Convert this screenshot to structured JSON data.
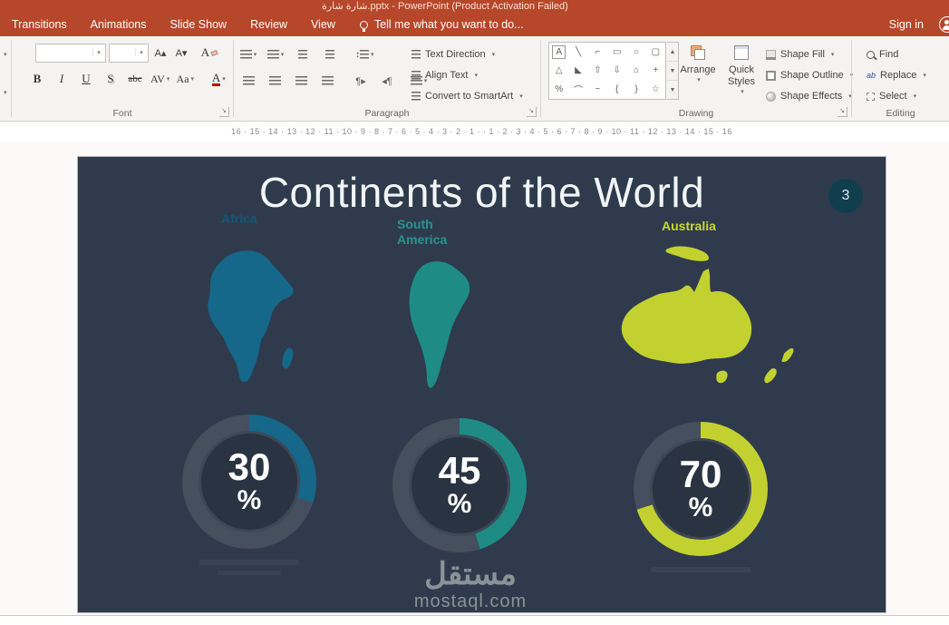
{
  "title_bar": {
    "title": "شارة شارة.pptx - PowerPoint (Product Activation Failed)"
  },
  "tab_bar": {
    "tabs": [
      "Transitions",
      "Animations",
      "Slide Show",
      "Review",
      "View"
    ],
    "tell_me": "Tell me what you want to do...",
    "sign_in": "Sign in"
  },
  "icons": {
    "caret": "▾",
    "launcher": "↘",
    "grow_font": "A▴",
    "shrink_font": "A▾",
    "updown": "↕",
    "pilcrow_ltr": "¶▸",
    "pilcrow_rtl": "◂¶",
    "scroll_up": "▲",
    "scroll_down": "▼",
    "scroll_more": "▼≡"
  },
  "font_group": {
    "label": "Font",
    "font_name_value": "",
    "font_size_value": "",
    "bold": "B",
    "italic": "I",
    "underline": "U",
    "shadow": "S",
    "strikethrough": "abc",
    "char_spacing": "AV",
    "change_case": "Aa",
    "font_color": "A",
    "clear_formatting": "A"
  },
  "paragraph_group": {
    "label": "Paragraph",
    "text_direction": "Text Direction",
    "align_text": "Align Text",
    "smartart": "Convert to SmartArt"
  },
  "drawing_group": {
    "label": "Drawing",
    "shapes": [
      "A",
      "╲",
      "⌐",
      "▭",
      "○",
      "▢",
      "△",
      "◣",
      "⇧",
      "⇩",
      "⌂",
      "+",
      "%",
      "⌒",
      "~",
      "{",
      "}",
      "☆"
    ],
    "arrange": "Arrange",
    "quick_styles_line1": "Quick",
    "quick_styles_line2": "Styles",
    "shape_fill": "Shape Fill",
    "shape_outline": "Shape Outline",
    "shape_effects": "Shape Effects"
  },
  "editing_group": {
    "label": "Editing",
    "find": "Find",
    "replace": "Replace",
    "replace_icon": "ab",
    "select": "Select"
  },
  "ruler": {
    "marks": "16 · 15 · 14 · 13 · 12 · 11 · 10 · 9 · 8 · 7 · 6 · 5 · 4 · 3 · 2 · 1 ·  · 1 · 2 · 3 · 4 · 5 · 6 · 7 · 8 · 9 · 10 · 11 · 12 · 13 · 14 · 15 · 16"
  },
  "slide": {
    "title": "Continents of the World",
    "page_number": "3",
    "percent_sign": "%",
    "donut_track": "#454f5d",
    "continents": [
      {
        "name": "Africa",
        "percent": 30,
        "fill": "#15688a",
        "label_color": "#15587a"
      },
      {
        "name": "South America",
        "percent": 45,
        "fill": "#1e8c84",
        "label_color": "#27948c"
      },
      {
        "name": "Australia",
        "percent": 70,
        "fill": "#c3d130",
        "label_color": "#c9d733"
      }
    ],
    "watermark_title": "مستقل",
    "watermark_domain": "mostaql.com"
  },
  "chart_data": {
    "type": "pie",
    "title": "Continents of the World",
    "categories": [
      "Africa",
      "South America",
      "Australia"
    ],
    "values": [
      30,
      45,
      70
    ],
    "note": "three donut gauges showing percent per continent"
  }
}
